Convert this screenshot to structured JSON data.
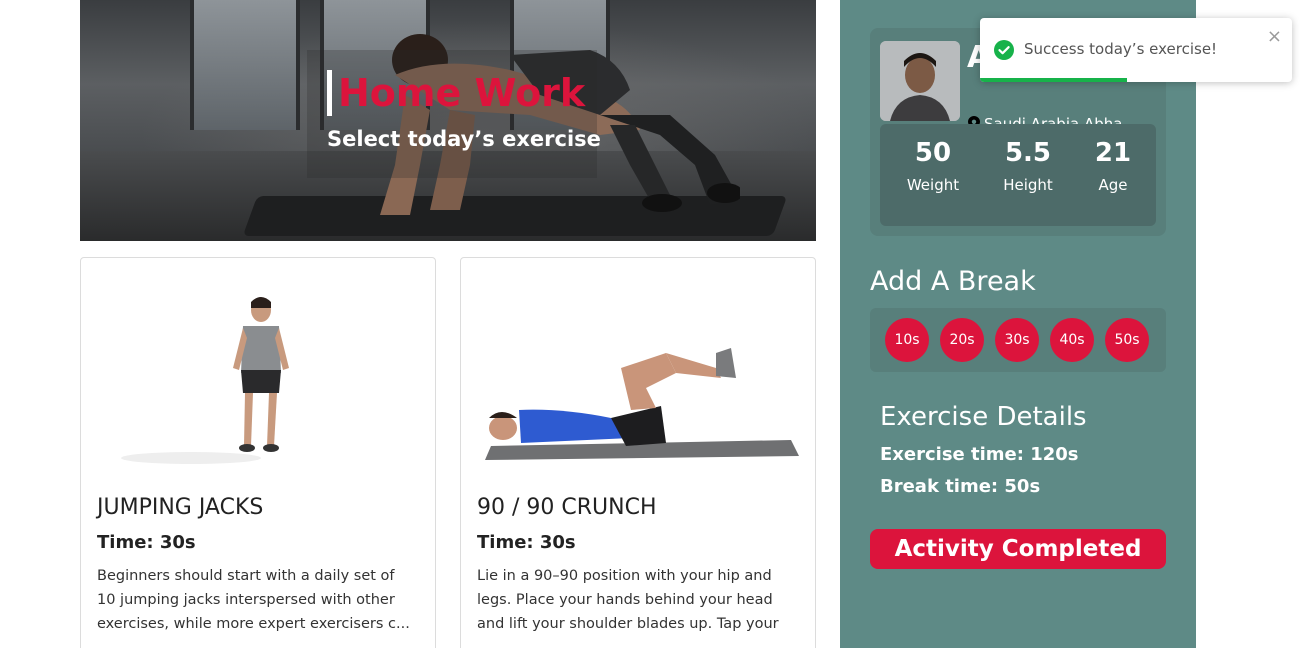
{
  "hero": {
    "title": "Home Work",
    "subtitle": "Select today’s exercise"
  },
  "exercises": [
    {
      "title": "JUMPING JACKS",
      "time": "Time: 30s",
      "description": "Beginners should start with a daily set of 10 jumping jacks interspersed with other exercises, while more expert exercisers c..."
    },
    {
      "title": "90 / 90 CRUNCH",
      "time": "Time: 30s",
      "description": "Lie in a 90–90 position with your hip and legs. Place your hands behind your head and lift your shoulder blades up. Tap your ..."
    }
  ],
  "profile": {
    "name_initial": "A",
    "location": "Saudi Arabia Abha",
    "stats": {
      "weight_value": "50",
      "weight_label": "Weight",
      "height_value": "5.5",
      "height_label": "Height",
      "age_value": "21",
      "age_label": "Age"
    }
  },
  "breaks": {
    "title": "Add A Break",
    "options": [
      "10s",
      "20s",
      "30s",
      "40s",
      "50s"
    ]
  },
  "details": {
    "title": "Exercise Details",
    "exercise_time": "Exercise time: 120s",
    "break_time": "Break time: 50s"
  },
  "actions": {
    "complete_label": "Activity Completed"
  },
  "toast": {
    "message": "Success today’s exercise!",
    "close": "×",
    "progress": 0.47
  },
  "colors": {
    "accent": "#dc143c",
    "sidebar": "#5e8a86",
    "panel": "#587f7b",
    "stats_panel": "#4d6b69",
    "success": "#17b24a"
  },
  "icons": {
    "location": "map-pin-icon",
    "toast": "check-circle-icon",
    "close": "close-icon"
  }
}
